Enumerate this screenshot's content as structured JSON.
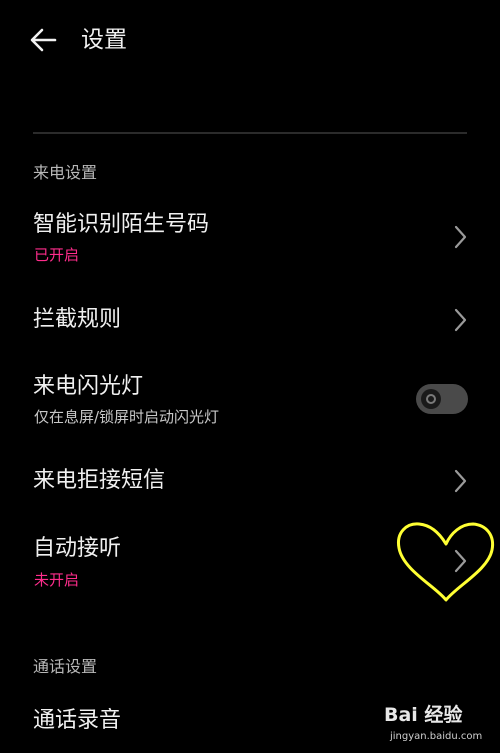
{
  "header": {
    "title": "设置"
  },
  "sections": [
    {
      "title": "来电设置",
      "rows": [
        {
          "title": "智能识别陌生号码",
          "subtitle": "已开启",
          "control": "chevron"
        },
        {
          "title": "拦截规则",
          "control": "chevron"
        },
        {
          "title": "来电闪光灯",
          "subtitle": "仅在息屏/锁屏时启动闪光灯",
          "control": "toggle",
          "toggle_on": false
        },
        {
          "title": "来电拒接短信",
          "control": "chevron"
        },
        {
          "title": "自动接听",
          "subtitle": "未开启",
          "control": "chevron"
        }
      ]
    },
    {
      "title": "通话设置",
      "rows": [
        {
          "title": "通话录音"
        }
      ]
    }
  ],
  "annotation": {
    "shape": "heart-icon",
    "color": "#ffff33"
  },
  "watermark": {
    "text": "Bai 经验",
    "url": "jingyan.baidu.com"
  },
  "colors": {
    "background": "#000000",
    "accent_pink": "#ff2d8c"
  }
}
